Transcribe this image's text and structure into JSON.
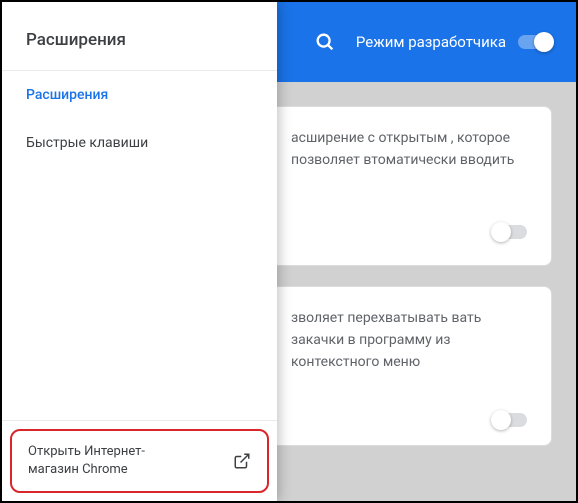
{
  "sidebar": {
    "title": "Расширения",
    "nav": [
      {
        "label": "Расширения",
        "active": true
      },
      {
        "label": "Быстрые клавиши",
        "active": false
      }
    ],
    "store_link": "Открыть Интернет-магазин Chrome"
  },
  "header": {
    "dev_mode_label": "Режим разработчика"
  },
  "cards": [
    {
      "text": "асширение с открытым , которое позволяет втоматически вводить"
    },
    {
      "text": "зволяет перехватывать вать закачки в программу из контекстного меню"
    }
  ],
  "icons": {
    "search": "search-icon",
    "external": "external-link-icon"
  }
}
